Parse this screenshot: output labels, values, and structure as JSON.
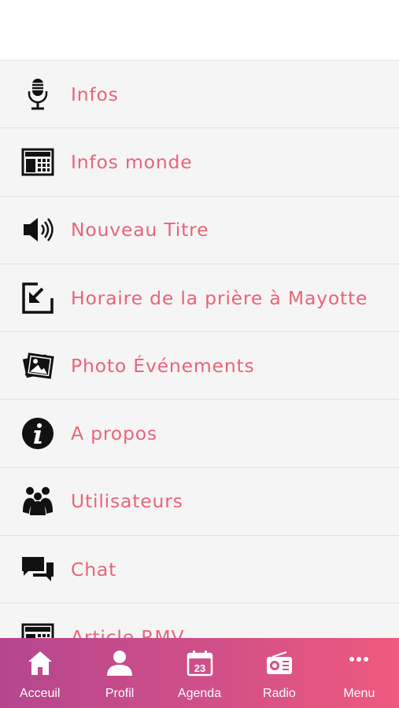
{
  "menu": {
    "items": [
      {
        "label": "Infos",
        "icon": "microphone-icon"
      },
      {
        "label": "Infos monde",
        "icon": "newspaper-icon"
      },
      {
        "label": "Nouveau Titre",
        "icon": "speaker-icon"
      },
      {
        "label": "Horaire de la prière à Mayotte",
        "icon": "arrow-box-icon"
      },
      {
        "label": "Photo Événements",
        "icon": "photo-icon"
      },
      {
        "label": "A propos",
        "icon": "info-icon"
      },
      {
        "label": "Utilisateurs",
        "icon": "users-icon"
      },
      {
        "label": "Chat",
        "icon": "chat-icon"
      },
      {
        "label": "Article RMV",
        "icon": "newspaper-icon"
      }
    ]
  },
  "tabbar": {
    "tabs": [
      {
        "label": "Acceuil",
        "icon": "home-icon"
      },
      {
        "label": "Profil",
        "icon": "user-icon"
      },
      {
        "label": "Agenda",
        "icon": "calendar-icon",
        "day": "23"
      },
      {
        "label": "Radio",
        "icon": "radio-icon"
      },
      {
        "label": "Menu",
        "icon": "more-icon"
      }
    ]
  },
  "colors": {
    "label": "#e86479",
    "tabbar_start": "#b5468e",
    "tabbar_end": "#ee5a7d"
  }
}
